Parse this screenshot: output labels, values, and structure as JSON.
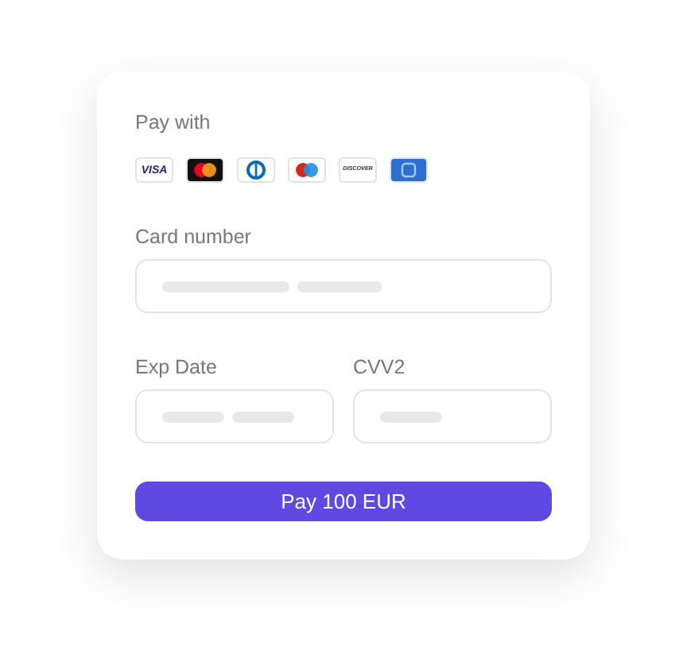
{
  "pay_with": {
    "label": "Pay with",
    "cards": [
      {
        "kind": "visa",
        "label": "VISA"
      },
      {
        "kind": "mastercard"
      },
      {
        "kind": "diners"
      },
      {
        "kind": "maestro"
      },
      {
        "kind": "discover",
        "label": "DISCOVER"
      },
      {
        "kind": "amex"
      }
    ]
  },
  "fields": [
    {
      "label": "Card number",
      "kind": "card"
    },
    {
      "label": "Exp Date",
      "kind": "exp"
    },
    {
      "label": "CVV2",
      "kind": "cvv"
    }
  ],
  "button": "Pay 100 EUR"
}
